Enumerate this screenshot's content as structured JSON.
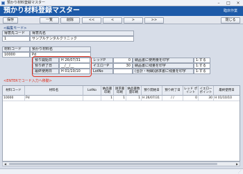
{
  "window": {
    "title": "預かり材料登録マスター",
    "minimize": "–",
    "maximize": "□",
    "close": "×"
  },
  "header": {
    "title": "預かり材料登録マスター",
    "user": "臨床作業"
  },
  "toolbar": {
    "save": "保存",
    "list": "一覧",
    "delete": "削除",
    "first": "<<",
    "prev": "<",
    "next": ">",
    "last": ">>",
    "close": "閉じる"
  },
  "mode_label": "<編集モード>",
  "client": {
    "code_label": "得意先コード",
    "name_label": "得意先名",
    "code": "1",
    "name": "サンプルデンタルクリニック"
  },
  "material": {
    "code_label": "材料コード",
    "name_label": "預かり材料名",
    "code": "10000",
    "name": "Pd"
  },
  "details": {
    "start_label": "預り開始日",
    "start_value": "H 26/07/31",
    "end_label": "預り終了日",
    "end_value": "__/__/__",
    "last_used_label": "最終使用日",
    "last_used_value": "H 01/10/10",
    "reorder_label": "レッドP",
    "reorder_value": "0",
    "reorder_note": "納品書に使用量を印字",
    "reorder_opt": "1:する",
    "yellow_label": "イエローP",
    "yellow_value": "30",
    "yellow_note": "納品書に残量を印字",
    "yellow_opt": "1:する",
    "lot_label": "LotNo",
    "lot_note": "(合計・明細)請求書に残量を印字",
    "lot_opt": "1:する"
  },
  "enter_label": "<ENTERでコード入力へ移動>",
  "grid": {
    "headers": [
      "材料コード",
      "材料名",
      "LotNo",
      "納品書 印刷",
      "請求書 印刷",
      "納品書数 量印刷",
      "預り開始日",
      "預り終了日",
      "レッド ポイント",
      "イエロー ポイント",
      "最終使用日"
    ],
    "rows": [
      [
        "10000",
        "Pd",
        "",
        "1",
        "1",
        "1",
        "H 26/07/31",
        "/ /",
        "0",
        "30",
        "H 01/10/10"
      ]
    ]
  }
}
